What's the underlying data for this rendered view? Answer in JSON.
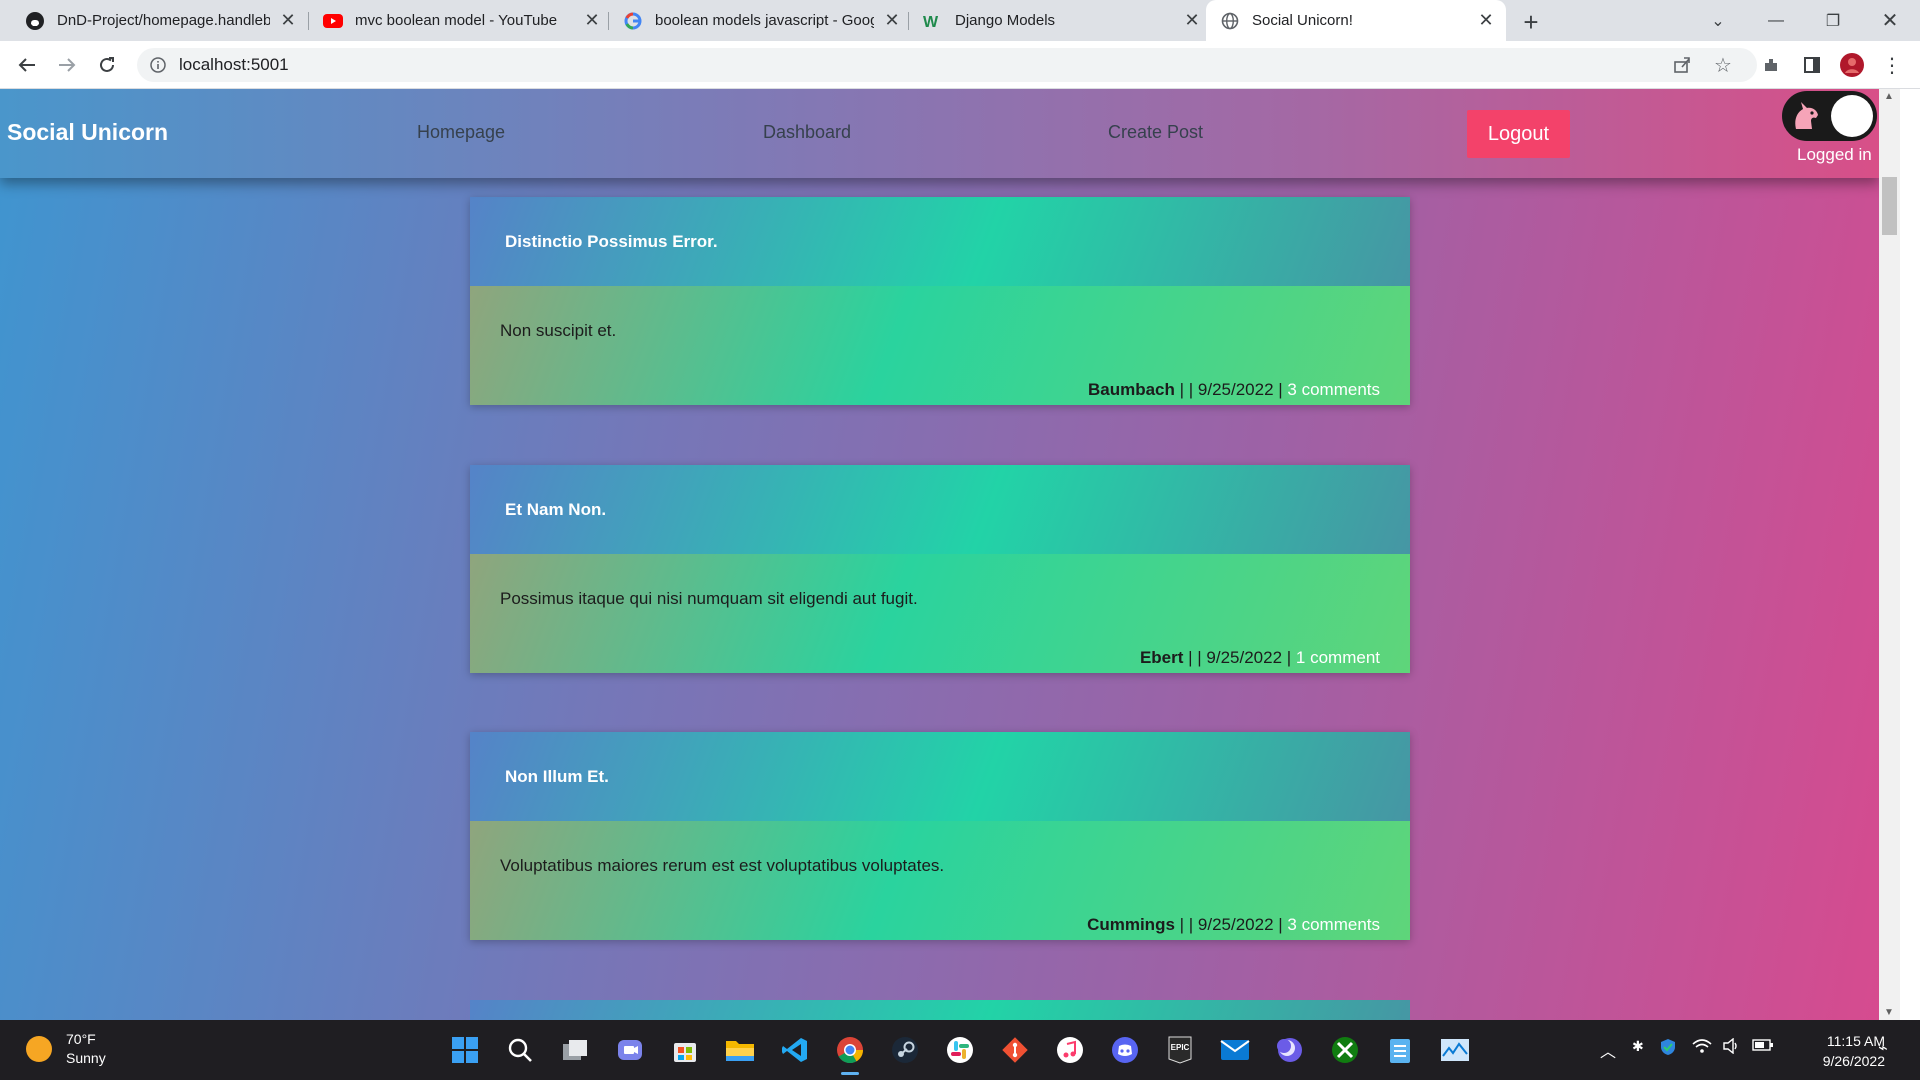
{
  "browser": {
    "tabs": [
      {
        "title": "DnD-Project/homepage.handlebars",
        "icon": "github-icon"
      },
      {
        "title": "mvc boolean model - YouTube",
        "icon": "youtube-icon"
      },
      {
        "title": "boolean models javascript - Google Search",
        "icon": "google-icon"
      },
      {
        "title": "Django Models",
        "icon": "w-icon"
      },
      {
        "title": "Social Unicorn!",
        "icon": "globe-icon",
        "active": true
      }
    ],
    "url": "localhost:5001"
  },
  "app": {
    "brand": "Social Unicorn",
    "nav": {
      "homepage": "Homepage",
      "dashboard": "Dashboard",
      "create_post": "Create Post"
    },
    "logout_label": "Logout",
    "status": "Logged in",
    "theme_toggle_on": true
  },
  "posts": [
    {
      "title": "Distinctio Possimus Error.",
      "body": "Non suscipit et.",
      "author": "Baumbach",
      "separator": " | | 9/25/2022 | ",
      "comments": "3 comments"
    },
    {
      "title": "Et Nam Non.",
      "body": "Possimus itaque qui nisi numquam sit eligendi aut fugit.",
      "author": "Ebert",
      "separator": " | | 9/25/2022 | ",
      "comments": "1 comment"
    },
    {
      "title": "Non Illum Et.",
      "body": "Voluptatibus maiores rerum est est voluptatibus voluptates.",
      "author": "Cummings",
      "separator": " | | 9/25/2022 | ",
      "comments": "3 comments"
    }
  ],
  "taskbar": {
    "weather": {
      "temp": "70°F",
      "condition": "Sunny"
    },
    "clock": {
      "time": "11:15 AM",
      "date": "9/26/2022"
    },
    "apps": [
      "windows-start-icon",
      "search-icon",
      "task-view-icon",
      "teams-chat-icon",
      "store-icon",
      "file-explorer-icon",
      "vscode-icon",
      "chrome-icon",
      "steam-icon",
      "slack-icon",
      "git-icon",
      "itunes-icon",
      "discord-icon",
      "epic-games-icon",
      "mail-icon",
      "moon-app-icon",
      "xbox-icon",
      "notepad-icon",
      "task-manager-icon"
    ]
  },
  "colors": {
    "logout": "#f3426a",
    "accent_pink": "#d84f88",
    "accent_blue": "#4a96cb"
  }
}
